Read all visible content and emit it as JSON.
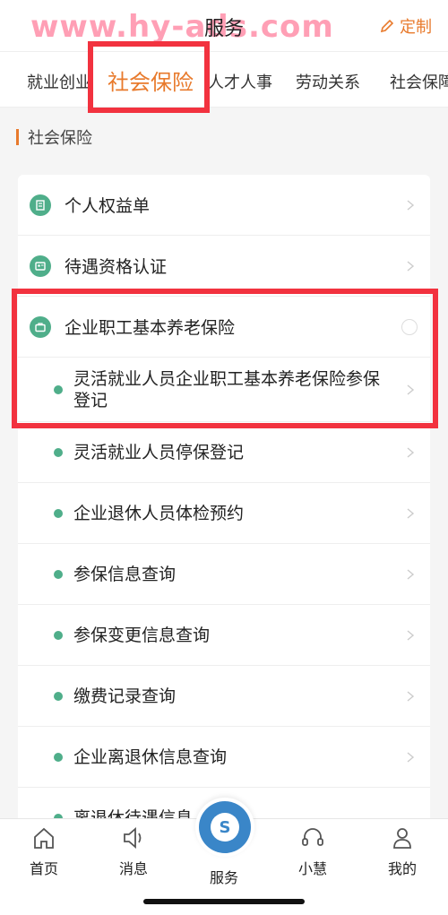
{
  "header": {
    "title": "服务",
    "watermark": "www.hy-ads.com",
    "customize_label": "定制"
  },
  "tabs": [
    {
      "label": "就业创业"
    },
    {
      "label": "社会保险",
      "active": true
    },
    {
      "label": "人才人事"
    },
    {
      "label": "劳动关系"
    },
    {
      "label": "社会保障"
    }
  ],
  "section": {
    "title": "社会保险"
  },
  "list": {
    "items": [
      {
        "label": "个人权益单",
        "icon": "document-icon"
      },
      {
        "label": "待遇资格认证",
        "icon": "id-card-icon"
      },
      {
        "label": "企业职工基本养老保险",
        "icon": "briefcase-icon",
        "expanded": true
      }
    ],
    "sub_items": [
      {
        "label": "灵活就业人员企业职工基本养老保险参保登记"
      },
      {
        "label": "灵活就业人员停保登记"
      },
      {
        "label": "企业退休人员体检预约"
      },
      {
        "label": "参保信息查询"
      },
      {
        "label": "参保变更信息查询"
      },
      {
        "label": "缴费记录查询"
      },
      {
        "label": "企业离退休信息查询"
      },
      {
        "label": "离退休待遇信息"
      }
    ]
  },
  "bottom_nav": [
    {
      "label": "首页",
      "icon": "home-icon"
    },
    {
      "label": "消息",
      "icon": "speaker-icon"
    },
    {
      "label": "服务",
      "icon": "service-logo-icon",
      "active": true
    },
    {
      "label": "小慧",
      "icon": "headset-icon"
    },
    {
      "label": "我的",
      "icon": "user-icon"
    }
  ],
  "colors": {
    "accent": "#e87a2c",
    "highlight": "#f2323f",
    "green": "#4fae8a"
  }
}
